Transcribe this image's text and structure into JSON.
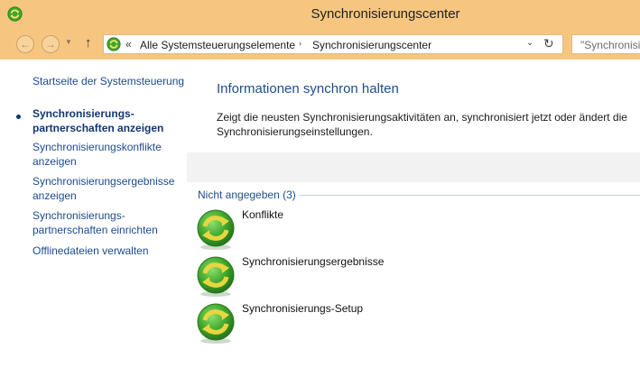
{
  "window": {
    "title": "Synchronisierungscenter"
  },
  "toolbar": {
    "back_glyph": "←",
    "forward_glyph": "→",
    "dropdown_glyph": "▼",
    "up_glyph": "↑",
    "address": {
      "prefix_glyph": "«",
      "crumbs": [
        "Alle Systemsteuerungselemente",
        "Synchronisierungscenter"
      ],
      "separator_glyph": "›",
      "dropdown_glyph": "⌄",
      "refresh_glyph": "↻"
    },
    "search": {
      "placeholder": "\"Synchronisi"
    }
  },
  "sidebar": {
    "items": [
      {
        "label": "Startseite der Systemsteuerung"
      },
      {
        "label": "Synchronisierungs-partnerschaften anzeigen",
        "active": true
      },
      {
        "label": "Synchronisierungskonflikte anzeigen"
      },
      {
        "label": "Synchronisierungsergebnisse anzeigen"
      },
      {
        "label": "Synchronisierungs-partnerschaften einrichten"
      },
      {
        "label": "Offlinedateien verwalten"
      }
    ]
  },
  "main": {
    "title": "Informationen synchron halten",
    "description": "Zeigt die neusten Synchronisierungsaktivitäten an, synchronisiert jetzt oder ändert die Synchronisierungseinstellungen.",
    "group": {
      "header": "Nicht angegeben (3)",
      "items": [
        {
          "label": "Konflikte",
          "icon": "sync-icon"
        },
        {
          "label": "Synchronisierungsergebnisse",
          "icon": "sync-icon"
        },
        {
          "label": "Synchronisierungs-Setup",
          "icon": "sync-icon"
        }
      ]
    }
  },
  "colors": {
    "chrome": "#f6c680",
    "link": "#1c4a8e",
    "heading": "#1e4d8a",
    "icon_green": "#3fa62c",
    "icon_arrow": "#e8d640"
  }
}
